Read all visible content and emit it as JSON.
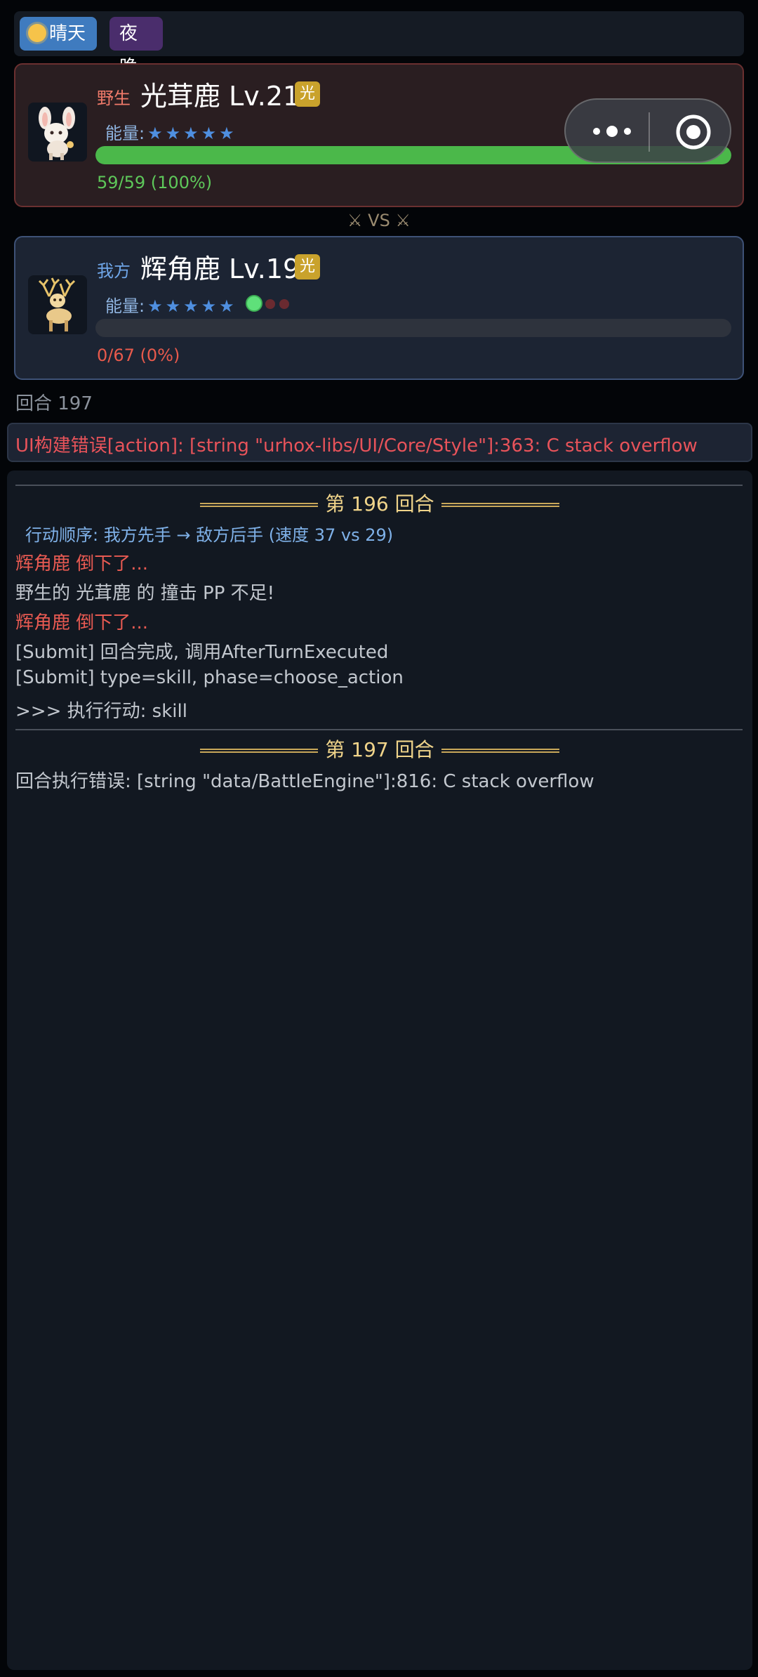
{
  "weather": {
    "day_label": "晴天",
    "night_label": "夜晚"
  },
  "wild": {
    "side": "野生",
    "name": "光茸鹿 Lv.21",
    "type": "光",
    "energy_label": "能量:",
    "stars": "★★★★★",
    "hp_text": "59/59 (100%)",
    "hp_fraction": 1.0
  },
  "vs_label": "⚔ VS ⚔",
  "mine": {
    "side": "我方",
    "name": "辉角鹿 Lv.19",
    "type": "光",
    "energy_label": "能量:",
    "stars": "★★★★★",
    "hp_text": "0/67 (0%)",
    "hp_fraction": 0
  },
  "round_label": "回合 197",
  "ui_error": "UI构建错误[action]: [string \"urhox-libs/UI/Core/Style\"]:363: C stack overflow",
  "log": {
    "round196": "第 196 回合",
    "order": "行动顺序: 我方先手 → 敌方后手 (速度 37 vs 29)",
    "faint1": "辉角鹿 倒下了...",
    "pp": "野生的 光茸鹿 的 撞击 PP 不足!",
    "faint2": "辉角鹿 倒下了...",
    "submit1": "[Submit] 回合完成, 调用AfterTurnExecuted",
    "submit2": "[Submit] type=skill, phase=choose_action",
    "exec": ">>> 执行行动: skill",
    "round197": "第 197 回合",
    "error": "回合执行错误: [string \"data/BattleEngine\"]:816: C stack overflow"
  },
  "colors": {
    "hp_green": "#4bb84a",
    "error_red": "#e85a52",
    "gold": "#f0d48a"
  }
}
